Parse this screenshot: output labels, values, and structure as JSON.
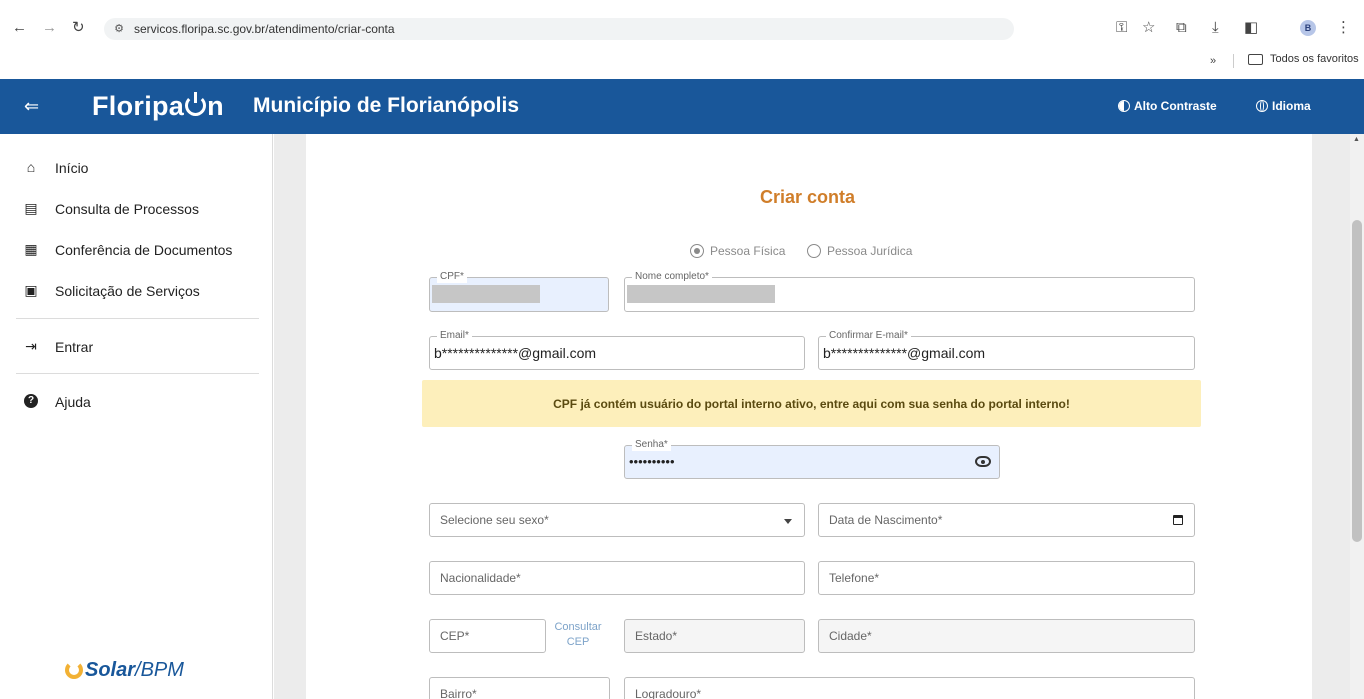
{
  "browser": {
    "url": "servicos.floripa.sc.gov.br/atendimento/criar-conta",
    "bookmarks_folder": "Todos os favoritos",
    "profile_initial": "B"
  },
  "header": {
    "logo_prefix": "Floripa",
    "logo_suffix": "n",
    "title": "Município de Florianópolis",
    "contrast_label": "Alto Contraste",
    "language_label": "Idioma"
  },
  "sidebar": {
    "items": [
      {
        "label": "Início",
        "icon": "home-icon"
      },
      {
        "label": "Consulta de Processos",
        "icon": "list-icon"
      },
      {
        "label": "Conferência de Documentos",
        "icon": "document-icon"
      },
      {
        "label": "Solicitação de Serviços",
        "icon": "folder-plus-icon"
      },
      {
        "label": "Entrar",
        "icon": "login-icon"
      },
      {
        "label": "Ajuda",
        "icon": "help-icon"
      }
    ],
    "footer_logo_a": "Solar",
    "footer_logo_b": "/BPM"
  },
  "form": {
    "title": "Criar conta",
    "person_types": [
      {
        "label": "Pessoa Física",
        "selected": true
      },
      {
        "label": "Pessoa Jurídica",
        "selected": false
      }
    ],
    "cpf_label": "CPF*",
    "name_label": "Nome completo*",
    "email_label": "Email*",
    "email_value": "b**************@gmail.com",
    "confirm_email_label": "Confirmar E-mail*",
    "confirm_email_value": "b**************@gmail.com",
    "alert_text": "CPF já contém usuário do portal interno ativo, entre aqui com sua senha do portal interno!",
    "password_label": "Senha*",
    "password_value": "••••••••••",
    "sex_placeholder": "Selecione seu sexo*",
    "birthdate_placeholder": "Data de Nascimento*",
    "nationality_placeholder": "Nacionalidade*",
    "phone_placeholder": "Telefone*",
    "cep_placeholder": "CEP*",
    "cep_link_line1": "Consultar",
    "cep_link_line2": "CEP",
    "state_placeholder": "Estado*",
    "city_placeholder": "Cidade*",
    "district_placeholder": "Bairro*",
    "street_placeholder": "Logradouro*"
  },
  "colors": {
    "header_bg": "#19579a",
    "title_accent": "#d07e2a",
    "alert_bg": "#fdefbb",
    "autofill_bg": "#e8f0fe"
  }
}
